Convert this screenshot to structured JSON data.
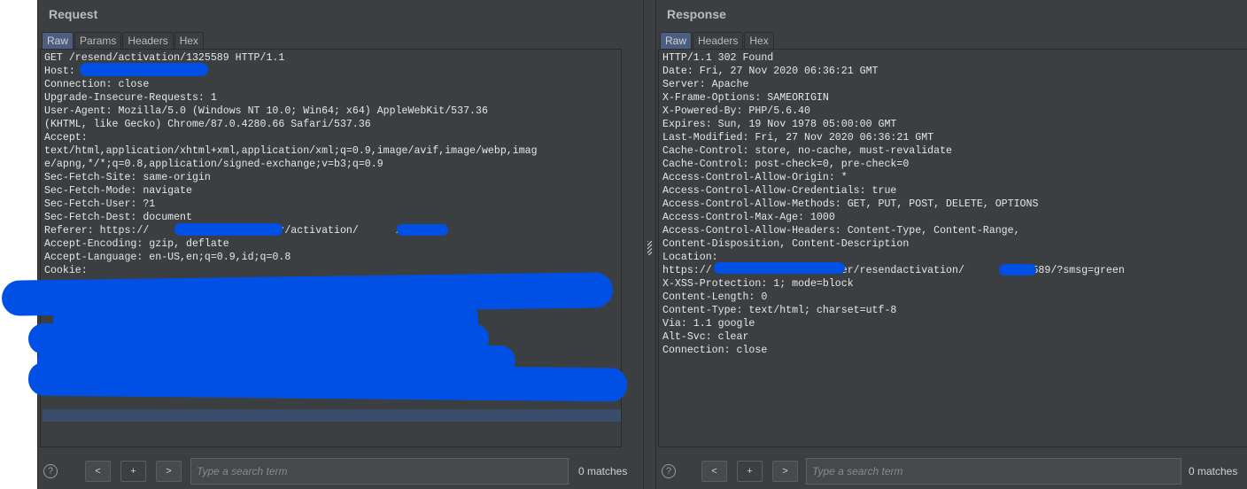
{
  "request": {
    "title": "Request",
    "tabs": [
      {
        "label": "Raw",
        "active": true
      },
      {
        "label": "Params",
        "active": false
      },
      {
        "label": "Headers",
        "active": false
      },
      {
        "label": "Hex",
        "active": false
      }
    ],
    "lines": [
      "GET /resend/activation/1325589 HTTP/1.1",
      "Host: ",
      "Connection: close",
      "Upgrade-Insecure-Requests: 1",
      "User-Agent: Mozilla/5.0 (Windows NT 10.0; Win64; x64) AppleWebKit/537.36",
      "(KHTML, like Gecko) Chrome/87.0.4280.66 Safari/537.36",
      "Accept:",
      "text/html,application/xhtml+xml,application/xml;q=0.9,image/avif,image/webp,imag",
      "e/apng,*/*;q=0.8,application/signed-exchange;v=b3;q=0.9",
      "Sec-Fetch-Site: same-origin",
      "Sec-Fetch-Mode: navigate",
      "Sec-Fetch-User: ?1",
      "Sec-Fetch-Dest: document",
      "Referer: https://                 /user/activation/      /1325589",
      "Accept-Encoding: gzip, deflate",
      "Accept-Language: en-US,en;q=0.9,id;q=0.8",
      "Cookie:"
    ],
    "search": {
      "prev_label": "<",
      "add_label": "+",
      "next_label": ">",
      "placeholder": "Type a search term",
      "value": "",
      "matches": "0 matches",
      "help_label": "?"
    }
  },
  "response": {
    "title": "Response",
    "tabs": [
      {
        "label": "Raw",
        "active": true
      },
      {
        "label": "Headers",
        "active": false
      },
      {
        "label": "Hex",
        "active": false
      }
    ],
    "lines": [
      "HTTP/1.1 302 Found",
      "Date: Fri, 27 Nov 2020 06:36:21 GMT",
      "Server: Apache",
      "X-Frame-Options: SAMEORIGIN",
      "X-Powered-By: PHP/5.6.40",
      "Expires: Sun, 19 Nov 1978 05:00:00 GMT",
      "Last-Modified: Fri, 27 Nov 2020 06:36:21 GMT",
      "Cache-Control: store, no-cache, must-revalidate",
      "Cache-Control: post-check=0, pre-check=0",
      "Access-Control-Allow-Origin: *",
      "Access-Control-Allow-Credentials: true",
      "Access-Control-Allow-Methods: GET, PUT, POST, DELETE, OPTIONS",
      "Access-Control-Max-Age: 1000",
      "Access-Control-Allow-Headers: Content-Type, Content-Range,",
      "Content-Disposition, Content-Description",
      "Location:",
      "https://                  /user/resendactivation/      /1325589/?smsg=green",
      "X-XSS-Protection: 1; mode=block",
      "Content-Length: 0",
      "Content-Type: text/html; charset=utf-8",
      "Via: 1.1 google",
      "Alt-Svc: clear",
      "Connection: close"
    ],
    "search": {
      "prev_label": "<",
      "add_label": "+",
      "next_label": ">",
      "placeholder": "Type a search term",
      "value": "",
      "matches": "0 matches",
      "help_label": "?"
    }
  },
  "colors": {
    "redaction": "#0050e6",
    "active_tab": "#4b5e80",
    "panel_bg": "#3c3f41"
  }
}
